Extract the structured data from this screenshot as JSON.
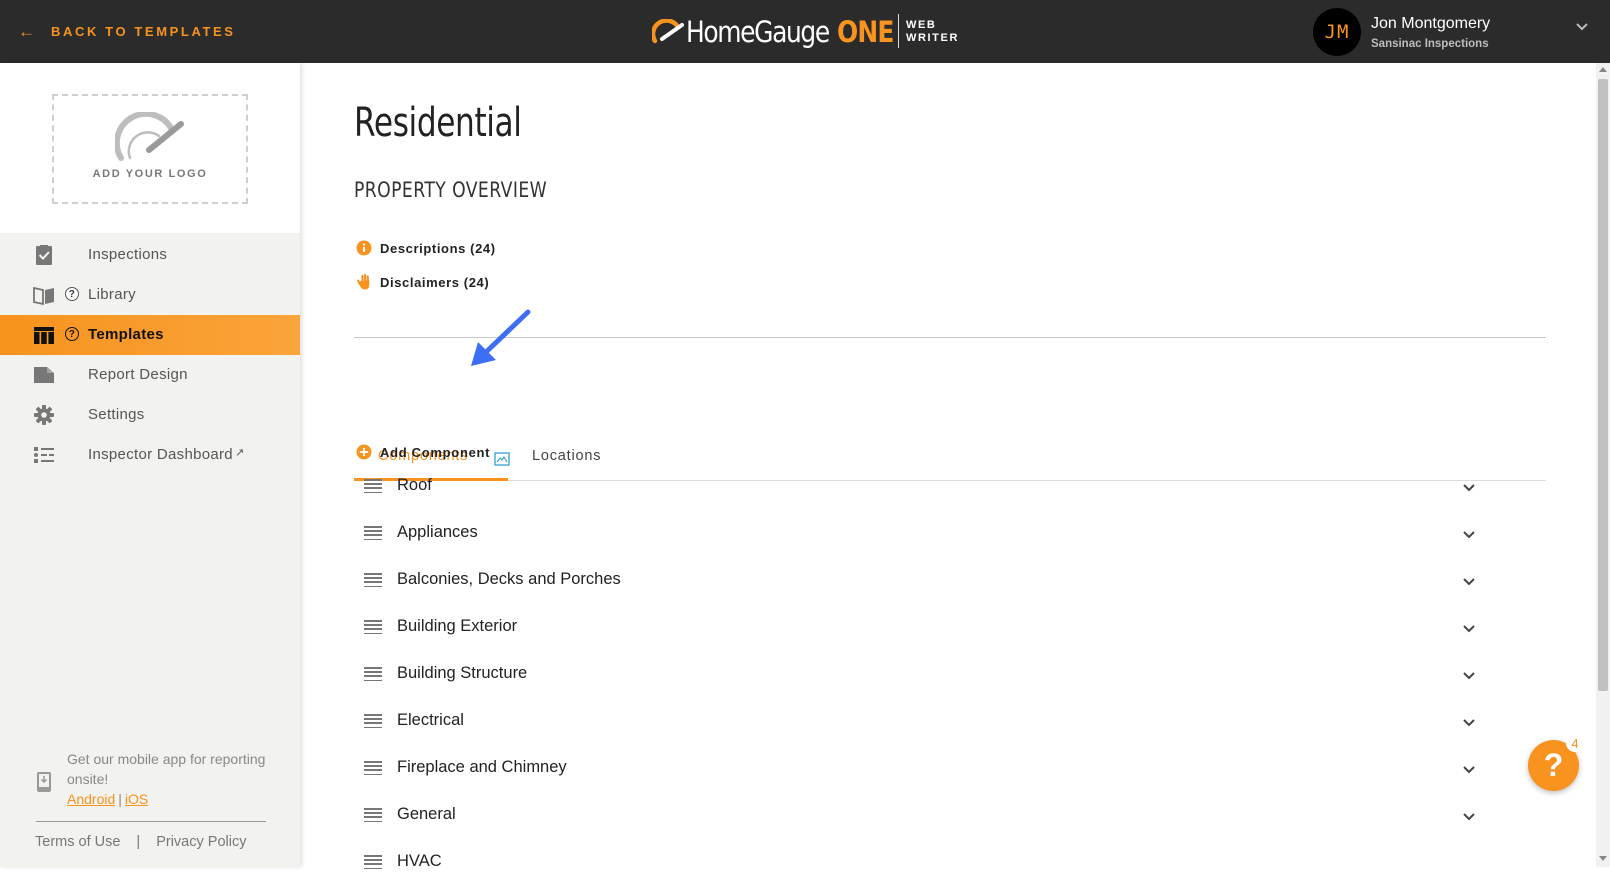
{
  "header": {
    "back_label": "BACK TO TEMPLATES",
    "brand_name": "HomeGauge",
    "brand_one": "ONE",
    "brand_web": "WEB",
    "brand_writer": "WRITER",
    "user_initials": "JM",
    "user_name": "Jon Montgomery",
    "user_company": "Sansinac Inspections"
  },
  "sidebar": {
    "logo_label": "ADD YOUR LOGO",
    "items": [
      {
        "label": "Inspections",
        "icon": "clipboard-check-icon"
      },
      {
        "label": "Library",
        "icon": "book-icon"
      },
      {
        "label": "Templates",
        "icon": "table-icon",
        "active": true
      },
      {
        "label": "Report Design",
        "icon": "folder-icon"
      },
      {
        "label": "Settings",
        "icon": "gear-icon"
      },
      {
        "label": "Inspector Dashboard",
        "icon": "dashboard-list-icon"
      }
    ],
    "help_mark": "?",
    "external_mark": "↗",
    "mobile_text": "Get our mobile app for reporting onsite!",
    "android": "Android",
    "ios": "iOS",
    "separator": "|",
    "terms": "Terms of Use",
    "pipe": "|",
    "privacy": "Privacy Policy"
  },
  "main": {
    "title": "Residential",
    "subtitle": "PROPERTY OVERVIEW",
    "descriptions": "Descriptions (24)",
    "disclaimers": "Disclaimers (24)",
    "tabs": [
      "Components",
      "Locations"
    ],
    "add_component": "Add Component",
    "components": [
      "Roof",
      "Appliances",
      "Balconies, Decks and Porches",
      "Building Exterior",
      "Building Structure",
      "Electrical",
      "Fireplace and Chimney",
      "General",
      "HVAC"
    ]
  },
  "help": {
    "mark": "?",
    "badge": "4"
  },
  "colors": {
    "accent": "#f7931e",
    "topbar": "#2b2b2b",
    "sidebar": "#f2f2ef",
    "annotation": "#3d6ef5"
  }
}
